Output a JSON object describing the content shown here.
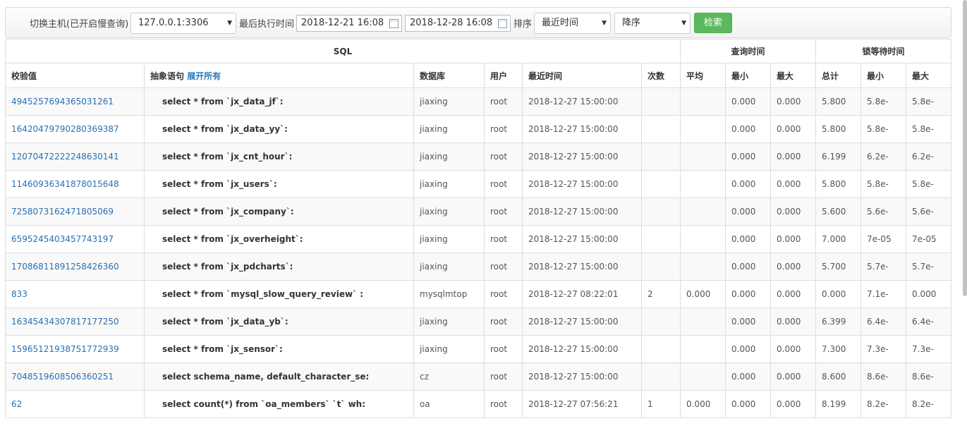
{
  "toolbar": {
    "host_label": "切换主机(已开启慢查询)",
    "host_value": "127.0.0.1:3306",
    "time_label": "最后执行时间",
    "date_from": "2018-12-21 16:08",
    "date_to": "2018-12-28 16:08",
    "sort_label": "排序",
    "sort_field": "最近时间",
    "sort_order": "降序",
    "search_label": "检索"
  },
  "table": {
    "group_headers": {
      "sql": "SQL",
      "query_time": "查询时间",
      "lock_time": "锁等待时间"
    },
    "columns": {
      "checksum": "校验值",
      "abstract": "抽象语句",
      "expand_all": "展开所有",
      "db": "数据库",
      "user": "用户",
      "last_time": "最近时间",
      "count": "次数",
      "qt_avg": "平均",
      "qt_min": "最小",
      "qt_max": "最大",
      "lt_total": "总计",
      "lt_min": "最小",
      "lt_max": "最大"
    },
    "rows": [
      [
        "4945257694365031261",
        "select * from `jx_data_jf`:",
        "jiaxing",
        "root",
        "2018-12-27 15:00:00",
        "",
        "",
        "0.000",
        "0.000",
        "5.800",
        "5.8e-",
        "5.8e-"
      ],
      [
        "16420479790280369387",
        "select * from `jx_data_yy`:",
        "jiaxing",
        "root",
        "2018-12-27 15:00:00",
        "",
        "",
        "0.000",
        "0.000",
        "5.800",
        "5.8e-",
        "5.8e-"
      ],
      [
        "12070472222248630141",
        "select * from `jx_cnt_hour`:",
        "jiaxing",
        "root",
        "2018-12-27 15:00:00",
        "",
        "",
        "0.000",
        "0.000",
        "6.199",
        "6.2e-",
        "6.2e-"
      ],
      [
        "11460936341878015648",
        "select * from `jx_users`:",
        "jiaxing",
        "root",
        "2018-12-27 15:00:00",
        "",
        "",
        "0.000",
        "0.000",
        "5.800",
        "5.8e-",
        "5.8e-"
      ],
      [
        "7258073162471805069",
        "select * from `jx_company`:",
        "jiaxing",
        "root",
        "2018-12-27 15:00:00",
        "",
        "",
        "0.000",
        "0.000",
        "5.600",
        "5.6e-",
        "5.6e-"
      ],
      [
        "6595245403457743197",
        "select * from `jx_overheight`:",
        "jiaxing",
        "root",
        "2018-12-27 15:00:00",
        "",
        "",
        "0.000",
        "0.000",
        "7.000",
        "7e-05",
        "7e-05"
      ],
      [
        "17086811891258426360",
        "select * from `jx_pdcharts`:",
        "jiaxing",
        "root",
        "2018-12-27 15:00:00",
        "",
        "",
        "0.000",
        "0.000",
        "5.700",
        "5.7e-",
        "5.7e-"
      ],
      [
        "833",
        "select * from `mysql_slow_query_review` :",
        "mysqlmtop",
        "root",
        "2018-12-27 08:22:01",
        "2",
        "0.000",
        "0.000",
        "0.000",
        "0.000",
        "7.1e-",
        "0.000"
      ],
      [
        "16345434307817177250",
        "select * from `jx_data_yb`:",
        "jiaxing",
        "root",
        "2018-12-27 15:00:00",
        "",
        "",
        "0.000",
        "0.000",
        "6.399",
        "6.4e-",
        "6.4e-"
      ],
      [
        "15965121938751772939",
        "select * from `jx_sensor`:",
        "jiaxing",
        "root",
        "2018-12-27 15:00:00",
        "",
        "",
        "0.000",
        "0.000",
        "7.300",
        "7.3e-",
        "7.3e-"
      ],
      [
        "7048519608506360251",
        "select schema_name, default_character_se:",
        "cz",
        "root",
        "2018-12-27 15:00:00",
        "",
        "",
        "0.000",
        "0.000",
        "8.600",
        "8.6e-",
        "8.6e-"
      ],
      [
        "62",
        "select count(*) from `oa_members` `t` wh:",
        "oa",
        "root",
        "2018-12-27 07:56:21",
        "1",
        "0.000",
        "0.000",
        "0.000",
        "8.199",
        "8.2e-",
        "8.2e-"
      ]
    ]
  }
}
